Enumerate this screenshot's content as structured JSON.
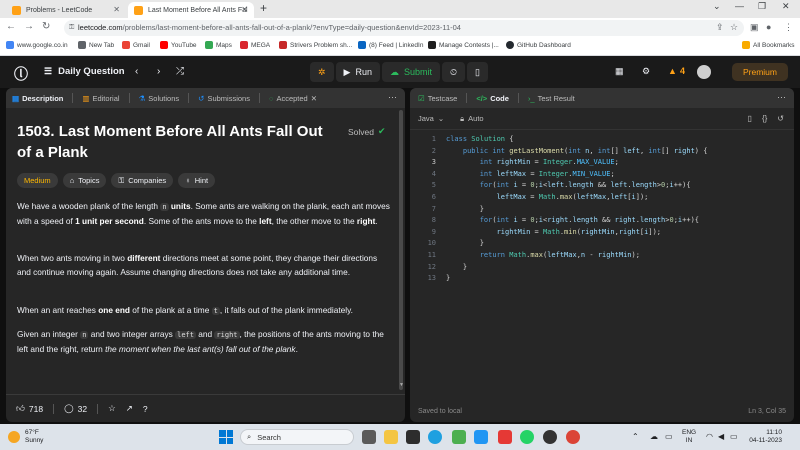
{
  "browser": {
    "tabs": [
      {
        "label": "Problems - LeetCode"
      },
      {
        "label": "Last Moment Before All Ants Fal"
      }
    ],
    "url_host": "leetcode.com",
    "url_path": "/problems/last-moment-before-all-ants-fall-out-of-a-plank/?envType=daily-question&envId=2023-11-04",
    "bookmarks": [
      "www.google.co.in",
      "New Tab",
      "Gmail",
      "YouTube",
      "Maps",
      "MEGA",
      "Strivers Problem sh...",
      "(8) Feed | LinkedIn",
      "Manage Contests |...",
      "GitHub Dashboard"
    ],
    "all_bookmarks": "All Bookmarks"
  },
  "header": {
    "daily_question": "Daily Question",
    "run": "Run",
    "submit": "Submit",
    "streak": "4",
    "premium": "Premium"
  },
  "left": {
    "tabs": [
      "Description",
      "Editorial",
      "Solutions",
      "Submissions",
      "Accepted"
    ],
    "title": "1503. Last Moment Before All Ants Fall Out of a Plank",
    "status": "Solved",
    "chips": [
      "Medium",
      "Topics",
      "Companies",
      "Hint"
    ],
    "desc": {
      "p1a": "We have a wooden plank of the length ",
      "p1_code": "n",
      "p1b": " units",
      "p1c": ". Some ants are walking on the plank, each ant moves with a speed of ",
      "p1d": "1 unit per second",
      "p1e": ". Some of the ants move to the ",
      "p1f": "left",
      "p1g": ", the other move to the ",
      "p1h": "right",
      "p1i": ".",
      "p2a": "When two ants moving in two ",
      "p2b": "different",
      "p2c": " directions meet at some point, they change their directions and continue moving again. Assume changing directions does not take any additional time.",
      "p3a": "When an ant reaches ",
      "p3b": "one end",
      "p3c": " of the plank at a time ",
      "p3_code": "t",
      "p3d": ", it falls out of the plank immediately.",
      "p4a": "Given an integer ",
      "p4_code1": "n",
      "p4b": " and two integer arrays ",
      "p4_code2": "left",
      "p4c": " and ",
      "p4_code3": "right",
      "p4d": ", the positions of the ants moving to the left and the right, return ",
      "p4e": "the moment when the last ant(s) fall out of the plank",
      "p4f": "."
    },
    "likes": "718",
    "comments": "32"
  },
  "right": {
    "tabs": [
      "Testcase",
      "Code",
      "Test Result"
    ],
    "language": "Java",
    "mode": "Auto",
    "saved": "Saved to local",
    "position": "Ln 3, Col 35",
    "line_numbers": [
      "1",
      "2",
      "3",
      "4",
      "5",
      "6",
      "7",
      "8",
      "9",
      "10",
      "11",
      "12",
      "13"
    ]
  },
  "taskbar": {
    "temp": "67°F",
    "weather": "Sunny",
    "search": "Search",
    "lang1": "ENG",
    "lang2": "IN",
    "time": "11:10",
    "date": "04-11-2023"
  },
  "colors": {
    "accent_orange": "#ffa116",
    "green": "#2cbb5d",
    "medium": "#ffb800"
  }
}
